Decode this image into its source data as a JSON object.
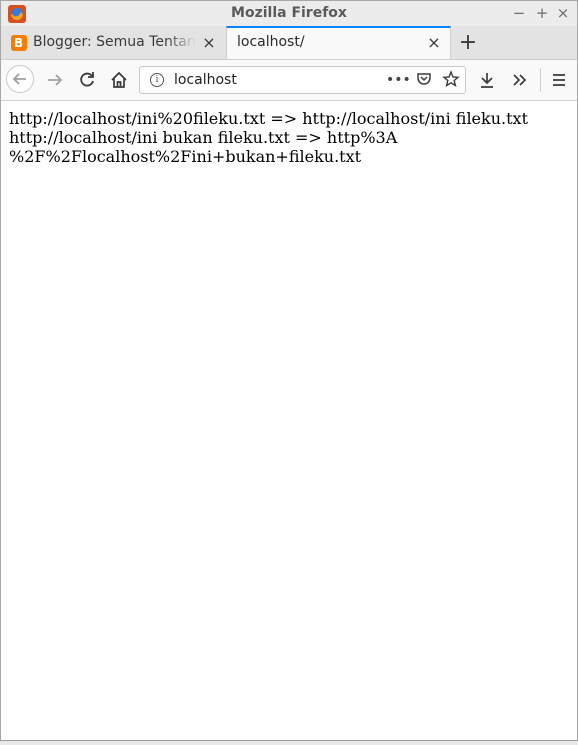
{
  "window": {
    "title": "Mozilla Firefox",
    "controls": {
      "minimize": "−",
      "maximize": "+",
      "close": "×"
    }
  },
  "tabs": [
    {
      "label": "Blogger: Semua Tentang",
      "active": false,
      "favicon": "blogger-icon"
    },
    {
      "label": "localhost/",
      "active": true
    }
  ],
  "newtab_label": "+",
  "navbar": {
    "url": "localhost",
    "icons": [
      "back-arrow-icon",
      "forward-arrow-icon",
      "reload-icon",
      "home-icon",
      "info-icon",
      "page-actions-icon",
      "pocket-icon",
      "bookmark-star-icon",
      "download-icon",
      "overflow-icon",
      "menu-icon"
    ]
  },
  "content": {
    "lines": [
      "http://localhost/ini%20fileku.txt => http://localhost/ini fileku.txt",
      "http://localhost/ini bukan fileku.txt => http%3A",
      "%2F%2Flocalhost%2Fini+bukan+fileku.txt"
    ]
  },
  "colors": {
    "accent": "#0a84ff",
    "tabstrip": "#e3e3e3",
    "toolbar": "#f9f9fa",
    "blogger": "#f57d00"
  }
}
